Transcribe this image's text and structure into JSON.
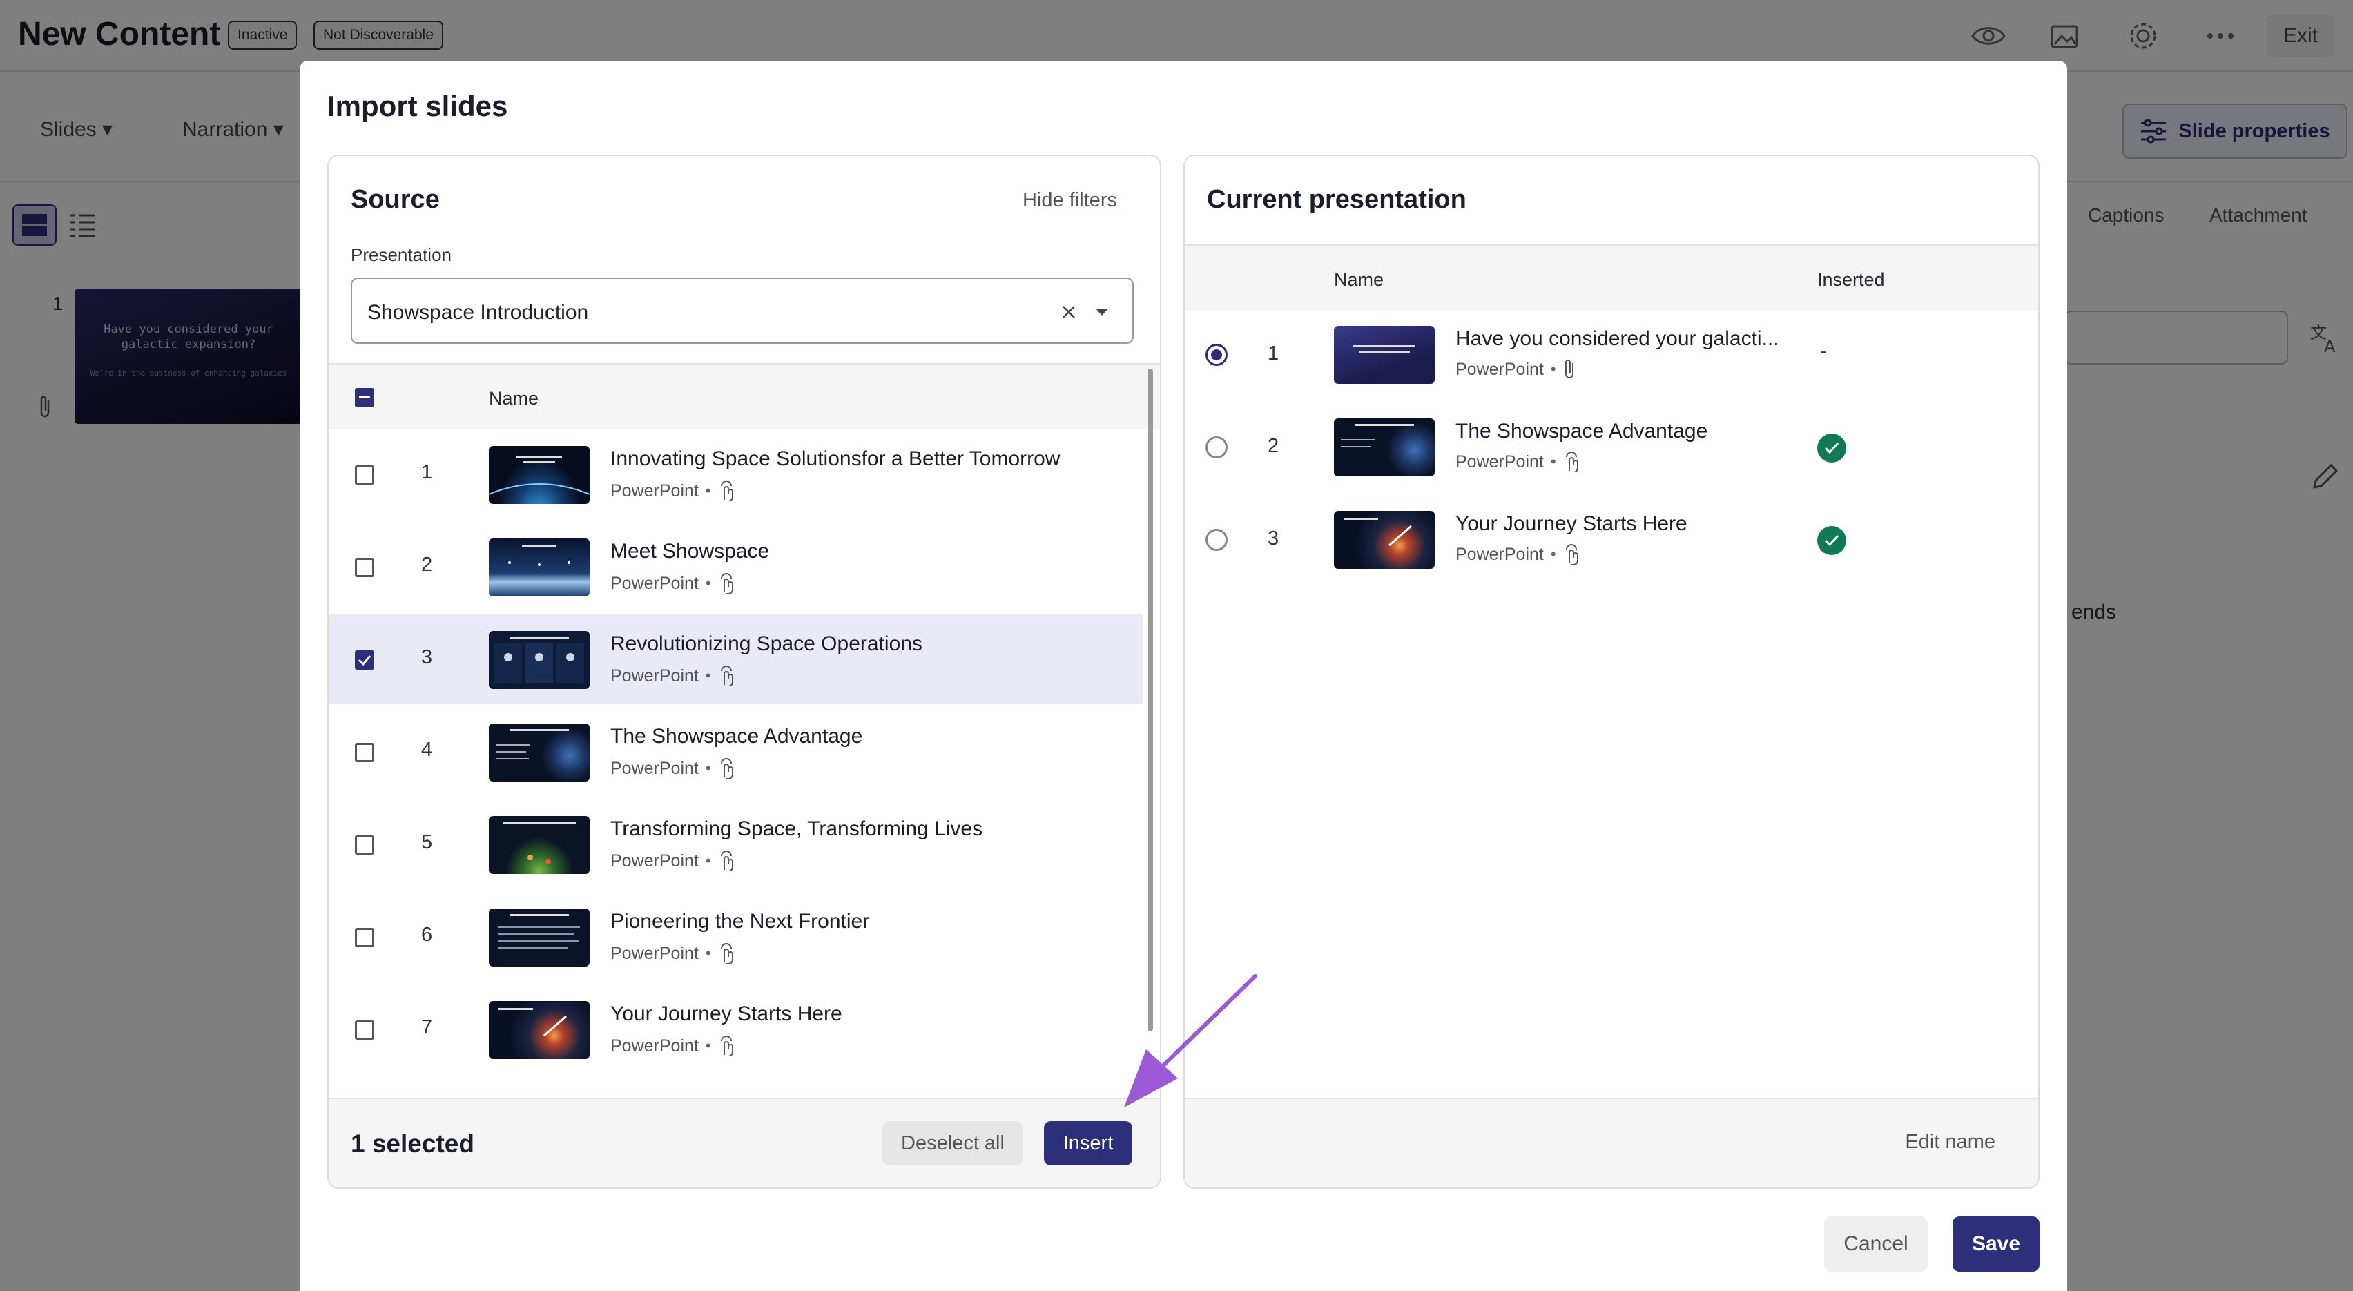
{
  "app": {
    "title": "New Content",
    "badges": [
      "Inactive",
      "Not Discoverable"
    ],
    "exit_label": "Exit",
    "menus": [
      "Slides",
      "Narration"
    ],
    "slide_properties_label": "Slide properties",
    "tabs": [
      "Captions",
      "Attachment"
    ],
    "slide_number": "1",
    "thumb_title": "Have you considered your galactic expansion?",
    "thumb_sub": "We're in the business of enhancing galaxies",
    "trailing_text": "ends"
  },
  "modal": {
    "title": "Import slides",
    "source": {
      "title": "Source",
      "hide_filters": "Hide filters",
      "field_label": "Presentation",
      "selected_presentation": "Showspace Introduction",
      "column_name": "Name",
      "rows": [
        {
          "num": "1",
          "name": "Innovating Space Solutionsfor a Better Tomorrow",
          "type": "PowerPoint",
          "checked": false
        },
        {
          "num": "2",
          "name": "Meet Showspace",
          "type": "PowerPoint",
          "checked": false
        },
        {
          "num": "3",
          "name": "Revolutionizing Space Operations",
          "type": "PowerPoint",
          "checked": true
        },
        {
          "num": "4",
          "name": "The Showspace Advantage",
          "type": "PowerPoint",
          "checked": false
        },
        {
          "num": "5",
          "name": "Transforming Space, Transforming Lives",
          "type": "PowerPoint",
          "checked": false
        },
        {
          "num": "6",
          "name": "Pioneering the Next Frontier",
          "type": "PowerPoint",
          "checked": false
        },
        {
          "num": "7",
          "name": "Your Journey Starts Here",
          "type": "PowerPoint",
          "checked": false
        }
      ],
      "selected_count": "1 selected",
      "deselect_all": "Deselect all",
      "insert": "Insert"
    },
    "current": {
      "title": "Current presentation",
      "column_name": "Name",
      "column_inserted": "Inserted",
      "rows": [
        {
          "num": "1",
          "name": "Have you considered your galacti...",
          "type": "PowerPoint",
          "inserted": "-",
          "selected": true
        },
        {
          "num": "2",
          "name": "The Showspace Advantage",
          "type": "PowerPoint",
          "inserted": "check",
          "selected": false
        },
        {
          "num": "3",
          "name": "Your Journey Starts Here",
          "type": "PowerPoint",
          "inserted": "check",
          "selected": false
        }
      ],
      "edit_name": "Edit name"
    },
    "cancel": "Cancel",
    "save": "Save"
  },
  "colors": {
    "primary": "#2e2f7a",
    "success": "#0f7a55",
    "annotation_arrow": "#9b59d6"
  }
}
